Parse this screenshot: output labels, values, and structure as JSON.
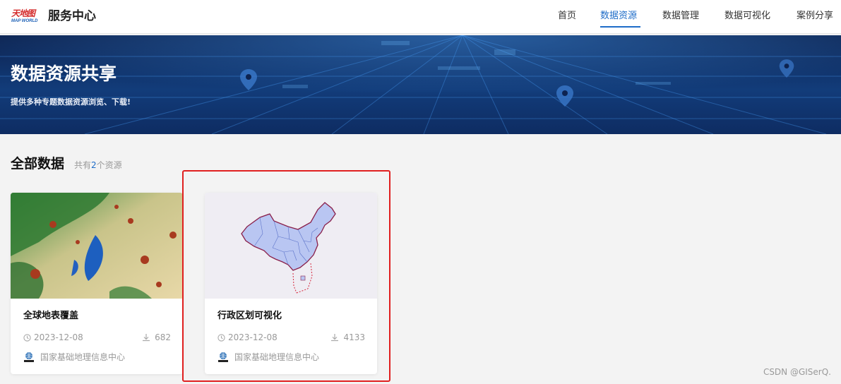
{
  "header": {
    "logo_text": "天地图",
    "logo_sub": "MAP WORLD",
    "title": "服务中心",
    "nav": [
      {
        "label": "首页",
        "active": false
      },
      {
        "label": "数据资源",
        "active": true
      },
      {
        "label": "数据管理",
        "active": false
      },
      {
        "label": "数据可视化",
        "active": false
      },
      {
        "label": "案例分享",
        "active": false
      }
    ]
  },
  "banner": {
    "title": "数据资源共享",
    "subtitle": "提供多种专题数据资源浏览、下载!"
  },
  "section": {
    "title": "全部数据",
    "count_prefix": "共有",
    "count_value": "2",
    "count_suffix": "个资源"
  },
  "cards": [
    {
      "title": "全球地表覆盖",
      "date": "2023-12-08",
      "downloads": "682",
      "org": "国家基础地理信息中心",
      "org_logo_text": "NGCC"
    },
    {
      "title": "行政区划可视化",
      "date": "2023-12-08",
      "downloads": "4133",
      "org": "国家基础地理信息中心",
      "org_logo_text": "NGCC"
    }
  ],
  "watermark": "CSDN @GISerQ.",
  "colors": {
    "accent": "#1e6cc8",
    "highlight": "#e02020"
  }
}
